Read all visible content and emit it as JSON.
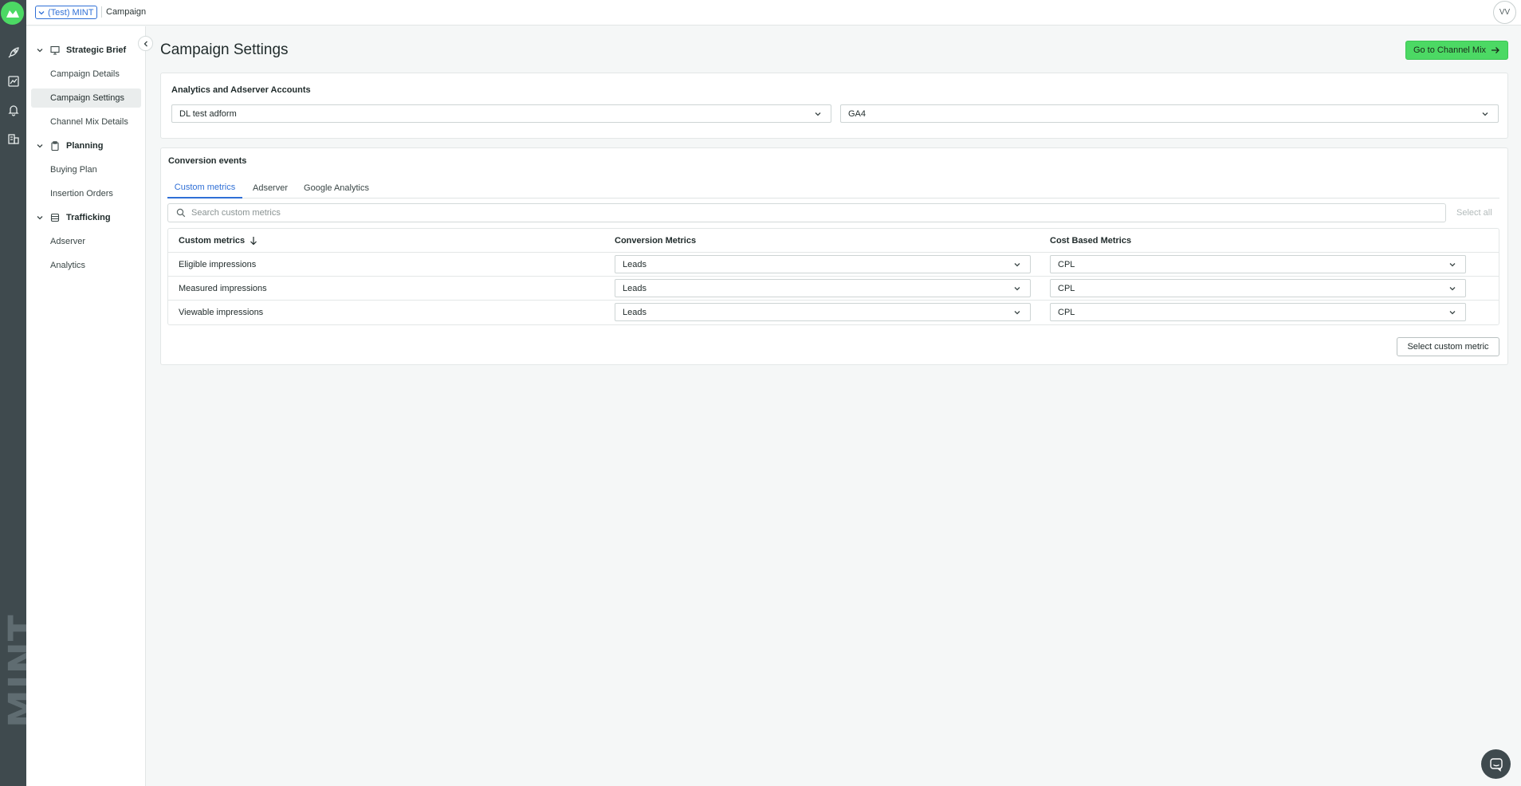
{
  "rail": {
    "brand": "MINT",
    "icons": [
      "rocket-icon",
      "chart-icon",
      "bell-icon",
      "building-icon"
    ]
  },
  "topbar": {
    "org_label": "(Test) MINT",
    "page_label": "Campaign",
    "avatar_initials": "VV"
  },
  "sidebar": {
    "sections": [
      {
        "label": "Strategic Brief",
        "icon": "presentation-icon",
        "items": [
          "Campaign Details",
          "Campaign Settings",
          "Channel Mix Details"
        ]
      },
      {
        "label": "Planning",
        "icon": "clipboard-icon",
        "items": [
          "Buying Plan",
          "Insertion Orders"
        ]
      },
      {
        "label": "Trafficking",
        "icon": "database-icon",
        "items": [
          "Adserver",
          "Analytics"
        ]
      }
    ],
    "active_item": "Campaign Settings"
  },
  "main": {
    "title": "Campaign Settings",
    "cta_label": "Go to Channel Mix",
    "accounts": {
      "title": "Analytics and Adserver Accounts",
      "adserver_value": "DL test adform",
      "analytics_value": "GA4"
    },
    "conversion": {
      "title": "Conversion events",
      "tabs": [
        "Custom metrics",
        "Adserver",
        "Google Analytics"
      ],
      "active_tab": "Custom metrics",
      "search_placeholder": "Search custom metrics",
      "select_all_label": "Select all",
      "columns": [
        "Custom metrics",
        "Conversion Metrics",
        "Cost Based Metrics"
      ],
      "rows": [
        {
          "metric": "Eligible impressions",
          "conversion": "Leads",
          "cost": "CPL"
        },
        {
          "metric": "Measured impressions",
          "conversion": "Leads",
          "cost": "CPL"
        },
        {
          "metric": "Viewable impressions",
          "conversion": "Leads",
          "cost": "CPL"
        }
      ],
      "select_custom_label": "Select custom metric"
    }
  },
  "colors": {
    "accent_green": "#4cd964",
    "link_blue": "#2f6fd6",
    "rail_dark": "#3f4a4e"
  }
}
